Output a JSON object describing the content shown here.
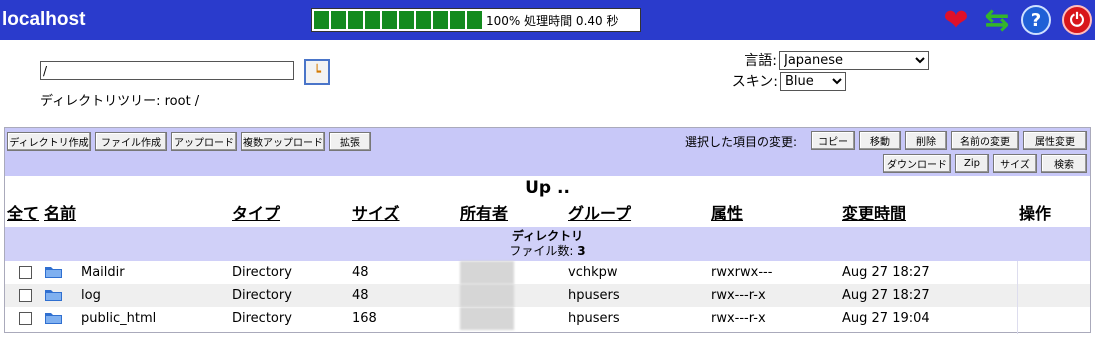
{
  "app": {
    "title": "localhost"
  },
  "progress": {
    "percent": 100,
    "segments": 10,
    "text": "100% 処理時間 0.40 秒"
  },
  "header_icons": [
    "heart-icon",
    "refresh-icon",
    "help-icon",
    "power-icon"
  ],
  "nav": {
    "path_value": "/",
    "tree_label": "ディレクトリツリー: root /"
  },
  "settings": {
    "language_label": "言語:",
    "language_value": "Japanese",
    "skin_label": "スキン:",
    "skin_value": "Blue"
  },
  "toolbar": {
    "left_buttons": [
      "ディレクトリ作成",
      "ファイル作成",
      "アップロード",
      "複数アップロード",
      "拡張"
    ],
    "selected_label": "選択した項目の変更:",
    "right_buttons_row1": [
      "コピー",
      "移動",
      "削除",
      "名前の変更",
      "属性変更"
    ],
    "right_buttons_row2": [
      "ダウンロード",
      "Zip",
      "サイズ",
      "検索"
    ]
  },
  "listing": {
    "up_label": "Up ..",
    "columns": [
      "全て",
      "名前",
      "タイプ",
      "サイズ",
      "所有者",
      "グループ",
      "属性",
      "変更時間",
      "操作"
    ],
    "section_title": "ディレクトリ",
    "section_count_label": "ファイル数:",
    "section_count": "3",
    "rows": [
      {
        "name": "Maildir",
        "type": "Directory",
        "size": "48",
        "group": "vchkpw",
        "perms": "rwxrwx---",
        "mtime": "Aug 27 18:27"
      },
      {
        "name": "log",
        "type": "Directory",
        "size": "48",
        "group": "hpusers",
        "perms": "rwx---r-x",
        "mtime": "Aug 27 18:27"
      },
      {
        "name": "public_html",
        "type": "Directory",
        "size": "168",
        "group": "hpusers",
        "perms": "rwx---r-x",
        "mtime": "Aug 27 19:04"
      }
    ]
  },
  "colors": {
    "header_bg": "#2a3bcc",
    "progress_fill": "#138a1e",
    "panel_bg": "#c8c8f8"
  }
}
